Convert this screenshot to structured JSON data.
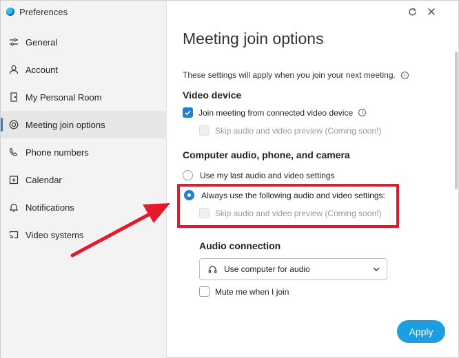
{
  "window": {
    "title": "Preferences",
    "icons": {
      "logo": "webex-logo",
      "refresh": "refresh-icon",
      "close": "close-icon"
    }
  },
  "sidebar": {
    "items": [
      {
        "label": "General",
        "icon": "sliders-icon",
        "active": false
      },
      {
        "label": "Account",
        "icon": "person-icon",
        "active": false
      },
      {
        "label": "My Personal Room",
        "icon": "door-icon",
        "active": false
      },
      {
        "label": "Meeting join options",
        "icon": "join-icon",
        "active": true
      },
      {
        "label": "Phone numbers",
        "icon": "phone-icon",
        "active": false
      },
      {
        "label": "Calendar",
        "icon": "calendar-icon",
        "active": false
      },
      {
        "label": "Notifications",
        "icon": "bell-icon",
        "active": false
      },
      {
        "label": "Video systems",
        "icon": "cast-icon",
        "active": false
      }
    ]
  },
  "main": {
    "title": "Meeting join options",
    "info": "These settings will apply when you join your next meeting.",
    "video_device": {
      "heading": "Video device",
      "join_connected": {
        "label": "Join meeting from connected video device",
        "checked": true
      },
      "skip_preview": {
        "label": "Skip audio and video preview (Coming soon!)",
        "checked": false,
        "disabled": true
      }
    },
    "computer_audio": {
      "heading": "Computer audio, phone, and camera",
      "use_last": {
        "label": "Use my last audio and video settings",
        "selected": false
      },
      "always_use": {
        "label": "Always use the following audio and video settings:",
        "selected": true
      },
      "skip_preview": {
        "label": "Skip audio and video preview (Coming soon!)",
        "checked": false,
        "disabled": true
      }
    },
    "audio_connection": {
      "heading": "Audio connection",
      "selected": "Use computer for audio",
      "mute": {
        "label": "Mute me when I join",
        "checked": false
      }
    },
    "apply_label": "Apply"
  },
  "colors": {
    "accent": "#1f7fd0",
    "apply": "#1b9fe0",
    "annotation": "#e21a2b"
  }
}
